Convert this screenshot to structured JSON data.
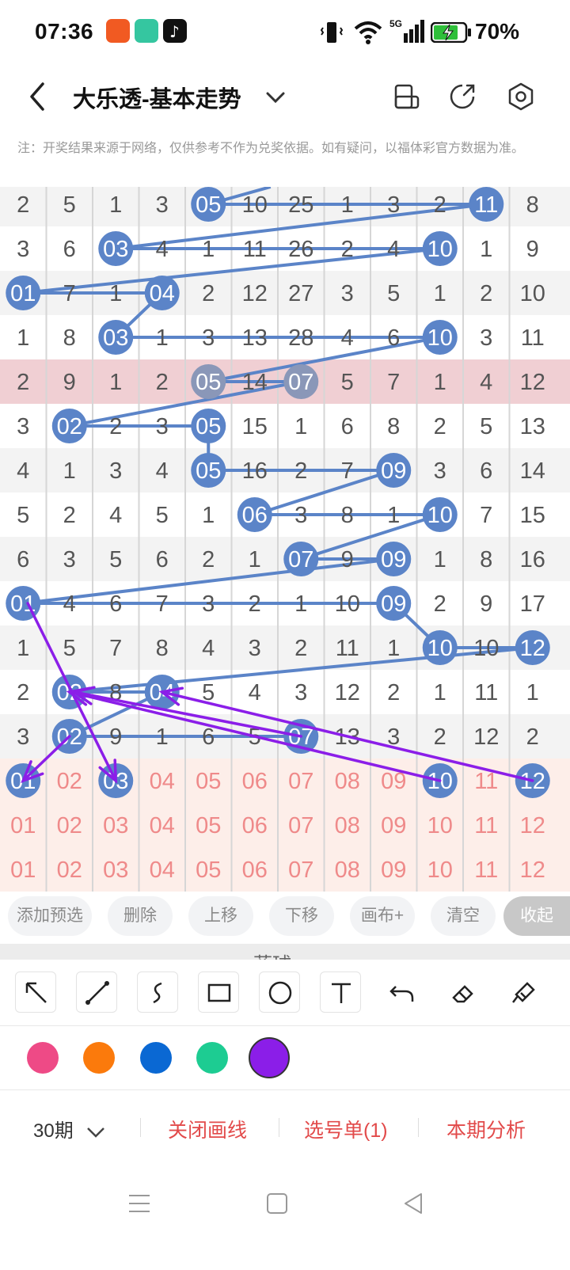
{
  "status_bar": {
    "time": "07:36",
    "battery": "70%",
    "network": "5G"
  },
  "header": {
    "title": "大乐透-基本走势"
  },
  "note": "注：开奖结果来源于网络，仅供参考不作为兑奖依据。如有疑问，以福体彩官方数据为准。",
  "colors": {
    "ball": "#5b84c8",
    "ball_dim": "#8a97b8",
    "highlight_row": "#f0cfd3",
    "candidate_bg": "#fdeee9",
    "candidate_text": "#ef8a8a",
    "annotation": "#8b1ee8",
    "link": "#e24a4a"
  },
  "grid": {
    "rows": [
      [
        "2",
        "5",
        "1",
        "3",
        "05",
        "10",
        "25",
        "1",
        "3",
        "2",
        "11",
        "8"
      ],
      [
        "3",
        "6",
        "03",
        "4",
        "1",
        "11",
        "26",
        "2",
        "4",
        "10",
        "1",
        "9"
      ],
      [
        "01",
        "7",
        "1",
        "04",
        "2",
        "12",
        "27",
        "3",
        "5",
        "1",
        "2",
        "10"
      ],
      [
        "1",
        "8",
        "03",
        "1",
        "3",
        "13",
        "28",
        "4",
        "6",
        "10",
        "3",
        "11"
      ],
      [
        "2",
        "9",
        "1",
        "2",
        "05",
        "14",
        "07",
        "5",
        "7",
        "1",
        "4",
        "12"
      ],
      [
        "3",
        "02",
        "2",
        "3",
        "05",
        "15",
        "1",
        "6",
        "8",
        "2",
        "5",
        "13"
      ],
      [
        "4",
        "1",
        "3",
        "4",
        "05",
        "16",
        "2",
        "7",
        "09",
        "3",
        "6",
        "14"
      ],
      [
        "5",
        "2",
        "4",
        "5",
        "1",
        "06",
        "3",
        "8",
        "1",
        "10",
        "7",
        "15"
      ],
      [
        "6",
        "3",
        "5",
        "6",
        "2",
        "1",
        "07",
        "9",
        "09",
        "1",
        "8",
        "16"
      ],
      [
        "01",
        "4",
        "6",
        "7",
        "3",
        "2",
        "1",
        "10",
        "09",
        "2",
        "9",
        "17"
      ],
      [
        "1",
        "5",
        "7",
        "8",
        "4",
        "3",
        "2",
        "11",
        "1",
        "10",
        "10",
        "12"
      ],
      [
        "2",
        "02",
        "8",
        "04",
        "5",
        "4",
        "3",
        "12",
        "2",
        "1",
        "11",
        "1"
      ],
      [
        "3",
        "02",
        "9",
        "1",
        "6",
        "5",
        "07",
        "13",
        "3",
        "2",
        "12",
        "2"
      ]
    ],
    "balls": [
      [
        [
          0,
          4
        ],
        [
          0,
          10
        ]
      ],
      [
        [
          1,
          2
        ],
        [
          1,
          9
        ]
      ],
      [
        [
          2,
          0
        ],
        [
          2,
          3
        ]
      ],
      [
        [
          3,
          2
        ],
        [
          3,
          9
        ]
      ],
      [
        [
          4,
          4
        ],
        [
          4,
          6
        ]
      ],
      [
        [
          5,
          1
        ],
        [
          5,
          4
        ]
      ],
      [
        [
          6,
          4
        ],
        [
          6,
          8
        ]
      ],
      [
        [
          7,
          5
        ],
        [
          7,
          9
        ]
      ],
      [
        [
          8,
          6
        ],
        [
          8,
          8
        ]
      ],
      [
        [
          9,
          0
        ],
        [
          9,
          8
        ]
      ],
      [
        [
          10,
          9
        ],
        [
          10,
          11
        ]
      ],
      [
        [
          11,
          1
        ],
        [
          11,
          3
        ]
      ],
      [
        [
          12,
          1
        ],
        [
          12,
          6
        ]
      ]
    ],
    "highlight_row": 4,
    "candidate_rows": [
      [
        "01",
        "02",
        "03",
        "04",
        "05",
        "06",
        "07",
        "08",
        "09",
        "10",
        "11",
        "12"
      ],
      [
        "01",
        "02",
        "03",
        "04",
        "05",
        "06",
        "07",
        "08",
        "09",
        "10",
        "11",
        "12"
      ],
      [
        "01",
        "02",
        "03",
        "04",
        "05",
        "06",
        "07",
        "08",
        "09",
        "10",
        "11",
        "12"
      ]
    ],
    "candidate_selected": [
      0,
      2,
      9,
      11
    ]
  },
  "actions": [
    "添加预选",
    "删除",
    "上移",
    "下移",
    "画布+",
    "清空",
    "收起"
  ],
  "section_label": "蓝球",
  "draw_tools": [
    "arrow-tool-icon",
    "line-tool-icon",
    "curve-tool-icon",
    "rectangle-tool-icon",
    "circle-tool-icon",
    "text-tool-icon",
    "undo-icon",
    "eraser-icon",
    "clear-brush-icon"
  ],
  "palette": [
    "#ee4a86",
    "#fb7a0c",
    "#0a68d3",
    "#1dcc92",
    "#8b1ee8"
  ],
  "bottom": {
    "period": "30期",
    "close_lines": "关闭画线",
    "selection": "选号单(1)",
    "analysis": "本期分析"
  }
}
